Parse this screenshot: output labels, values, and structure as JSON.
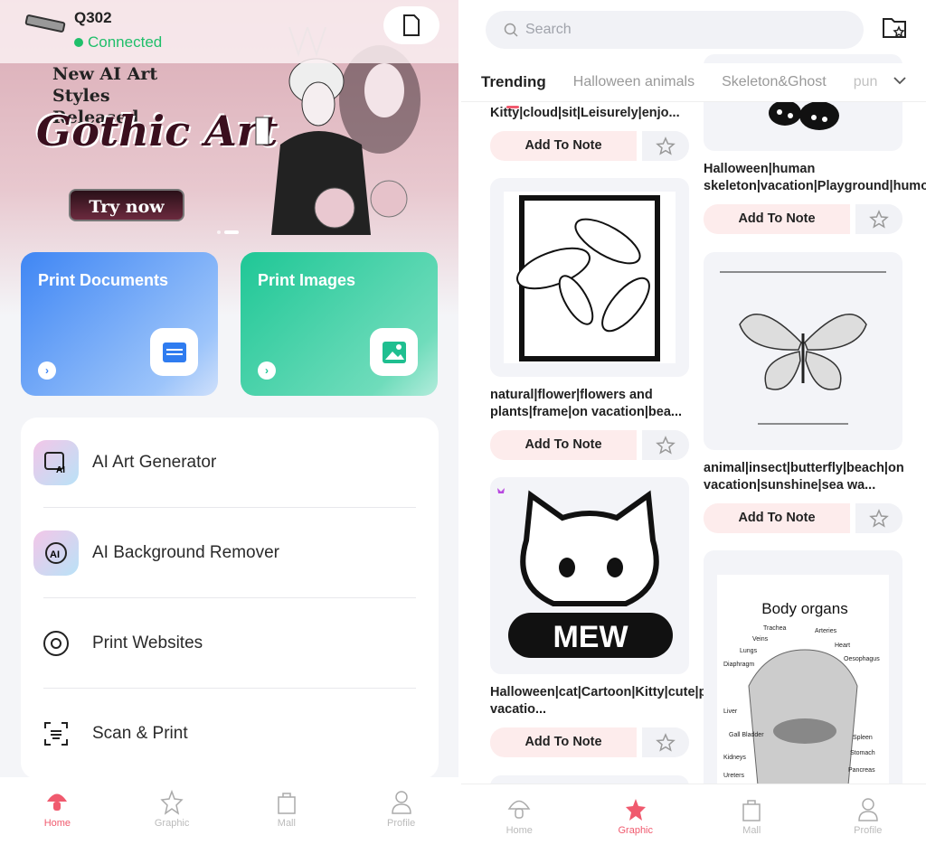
{
  "home": {
    "device_name": "Q302",
    "status": "Connected",
    "banner": {
      "headline": "New AI Art Styles Released",
      "title": "Gothic Art",
      "cta": "Try now",
      "slides": 2,
      "active_slide": 2
    },
    "cards": [
      {
        "label": "Print Documents",
        "color": "#4a90f5"
      },
      {
        "label": "Print Images",
        "color": "#2fcf9d"
      }
    ],
    "menu": [
      {
        "label": "AI Art Generator",
        "icon": "ai-image-icon"
      },
      {
        "label": "AI Background Remover",
        "icon": "ai-remove-bg-icon"
      },
      {
        "label": "Print Websites",
        "icon": "chrome-icon"
      },
      {
        "label": "Scan & Print",
        "icon": "scan-icon"
      }
    ],
    "nav": [
      {
        "label": "Home",
        "active": true
      },
      {
        "label": "Graphic",
        "active": false
      },
      {
        "label": "Mall",
        "active": false
      },
      {
        "label": "Profile",
        "active": false
      }
    ]
  },
  "graphic": {
    "search_placeholder": "Search",
    "tabs": [
      "Trending",
      "Halloween animals",
      "Skeleton&Ghost",
      "pun"
    ],
    "add_label": "Add To Note",
    "left_items": [
      {
        "caption": "Kitty|cloud|sit|Leisurely|enjo..."
      },
      {
        "caption": "natural|flower|flowers and plants|frame|on vacation|bea..."
      },
      {
        "caption": "Halloween|cat|Cartoon|Kitty|cute|pattern|summer vacatio...",
        "image_text": "MEW",
        "premium": true
      }
    ],
    "right_items": [
      {
        "caption": "Halloween|human skeleton|vacation|Playground|humor|..."
      },
      {
        "caption": "animal|insect|butterfly|beach|on vacation|sunshine|sea wa..."
      },
      {
        "image_title": "Body organs",
        "image_labels": [
          "Trachea",
          "Arteries",
          "Veins",
          "Heart",
          "Lungs",
          "Oesophagus",
          "Diaphragm",
          "Liver",
          "Gall Bladder",
          "Spleen",
          "Stomach",
          "Kidneys",
          "Pancreas",
          "Ureters"
        ]
      }
    ],
    "nav": [
      {
        "label": "Home",
        "active": false
      },
      {
        "label": "Graphic",
        "active": true
      },
      {
        "label": "Mall",
        "active": false
      },
      {
        "label": "Profile",
        "active": false
      }
    ],
    "accent": "#f05a6e"
  }
}
